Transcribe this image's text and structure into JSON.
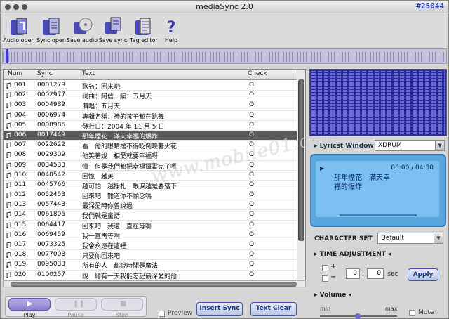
{
  "window": {
    "title": "mediaSync 2.0",
    "tag": "#25044"
  },
  "toolbar": [
    {
      "label": "Audio open",
      "icon": "audio-open-icon"
    },
    {
      "label": "Sync open",
      "icon": "sync-open-icon"
    },
    {
      "label": "Save audio",
      "icon": "save-audio-icon"
    },
    {
      "label": "Save sync",
      "icon": "save-sync-icon"
    },
    {
      "label": "Tag editor",
      "icon": "tag-editor-icon"
    },
    {
      "label": "Help",
      "icon": "help-icon"
    }
  ],
  "table": {
    "columns": [
      "Num",
      "Sync",
      "Text",
      "Check"
    ],
    "selected_index": 5,
    "rows": [
      {
        "num": "001",
        "sync": "0001279",
        "text": "歌名：回來吧",
        "check": "O"
      },
      {
        "num": "002",
        "sync": "0002977",
        "text": "詞曲：阿信　編：五月天",
        "check": "O"
      },
      {
        "num": "003",
        "sync": "0004989",
        "text": "演唱：五月天",
        "check": "O"
      },
      {
        "num": "004",
        "sync": "0006974",
        "text": "專輯名稱：神的孩子都在跳舞",
        "check": "O"
      },
      {
        "num": "005",
        "sync": "0008986",
        "text": "發行日：2004 年 11 月 5 日",
        "check": "O"
      },
      {
        "num": "006",
        "sync": "0017449",
        "text": "那年煙花　滿天幸福的爆炸",
        "check": "O"
      },
      {
        "num": "007",
        "sync": "0022622",
        "text": "看　他的眼睛捨不得眨倒映著火花",
        "check": "O"
      },
      {
        "num": "008",
        "sync": "0029309",
        "text": "他笑著說　相愛就要幸福呀",
        "check": "O"
      },
      {
        "num": "009",
        "sync": "0034533",
        "text": "懂　但是我們都把幸福揮霍完了嗎",
        "check": "O"
      },
      {
        "num": "010",
        "sync": "0040542",
        "text": "回憶　越美",
        "check": "O"
      },
      {
        "num": "011",
        "sync": "0045766",
        "text": "越可怕　越掙扎　眼淚越是要落下",
        "check": "O"
      },
      {
        "num": "012",
        "sync": "0052453",
        "text": "回來吧　難道你不願念嗎",
        "check": "O"
      },
      {
        "num": "013",
        "sync": "0057443",
        "text": "最深愛時你曾說過",
        "check": "O"
      },
      {
        "num": "014",
        "sync": "0061805",
        "text": "我們就是童話",
        "check": "O"
      },
      {
        "num": "015",
        "sync": "0064417",
        "text": "回來吧　我還一直在等啊",
        "check": "O"
      },
      {
        "num": "016",
        "sync": "0069459",
        "text": "我一直再等啊",
        "check": "O"
      },
      {
        "num": "017",
        "sync": "0073325",
        "text": "我會永遠在這裡",
        "check": "O"
      },
      {
        "num": "018",
        "sync": "0077008",
        "text": "只要你回來吧",
        "check": "O"
      },
      {
        "num": "019",
        "sync": "0095033",
        "text": "所有的人　都說時間是魔法",
        "check": "O"
      },
      {
        "num": "020",
        "sync": "0100257",
        "text": "說　總有一天我能忘記最深愛的他",
        "check": "O"
      }
    ]
  },
  "lyrics_window": {
    "label": "Lyricst Window",
    "select_value": "XDRUM",
    "time": "00:00 / 04:30",
    "lyric_line1": "那年煙花　滿天幸",
    "lyric_line2": "福的爆炸"
  },
  "charset": {
    "label": "CHARACTER SET",
    "value": "Default"
  },
  "time_adjust": {
    "label": "TIME ADJUSTMENT",
    "plus": "+",
    "minus": "−",
    "value_a": "0",
    "value_b": "0",
    "unit": "SEC",
    "apply_label": "Apply"
  },
  "volume": {
    "label": "Volume",
    "min_label": "min",
    "max_label": "max",
    "mute_label": "Mute"
  },
  "transport": {
    "play": "Play",
    "pause": "Pause",
    "stop": "Stop"
  },
  "bottom": {
    "preview_label": "Preview",
    "insert_sync": "Insert Sync",
    "text_clear": "Text Clear"
  },
  "watermark": "www.mobile01.com"
}
